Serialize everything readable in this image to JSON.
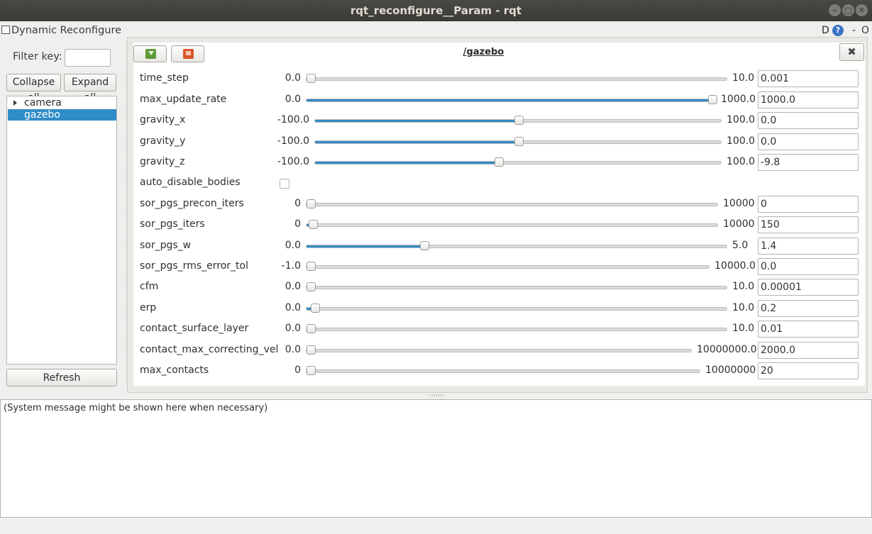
{
  "window": {
    "title": "rqt_reconfigure__Param - rqt",
    "min_glyph": "–",
    "max_glyph": "□",
    "close_glyph": "✕"
  },
  "plugin": {
    "title": "Dynamic Reconfigure",
    "d_label": "D",
    "help_glyph": "?",
    "dash_label": "-",
    "o_label": "O"
  },
  "left_panel": {
    "filter_label": "Filter key:",
    "filter_value": "",
    "collapse_label": "Collapse all",
    "expand_label": "Expand all",
    "refresh_label": "Refresh",
    "tree": [
      {
        "label": "camera",
        "selected": false,
        "expandable": true
      },
      {
        "label": "gazebo",
        "selected": true,
        "expandable": false
      }
    ]
  },
  "group": {
    "title": "/gazebo",
    "close_glyph": "✖",
    "params": [
      {
        "name": "time_step",
        "min": "0.0",
        "max": "10.0",
        "value": "0.001",
        "fraction": 0.0001
      },
      {
        "name": "max_update_rate",
        "min": "0.0",
        "max": "1000.0",
        "value": "1000.0",
        "fraction": 1.0
      },
      {
        "name": "gravity_x",
        "min": "-100.0",
        "max": "100.0",
        "value": "0.0",
        "fraction": 0.5
      },
      {
        "name": "gravity_y",
        "min": "-100.0",
        "max": "100.0",
        "value": "0.0",
        "fraction": 0.5
      },
      {
        "name": "gravity_z",
        "min": "-100.0",
        "max": "100.0",
        "value": "-9.8",
        "fraction": 0.451
      },
      {
        "name": "auto_disable_bodies",
        "type": "bool",
        "checked": false
      },
      {
        "name": "sor_pgs_precon_iters",
        "min": "0",
        "max": "10000",
        "value": "0",
        "fraction": 0.0
      },
      {
        "name": "sor_pgs_iters",
        "min": "0",
        "max": "10000",
        "value": "150",
        "fraction": 0.015
      },
      {
        "name": "sor_pgs_w",
        "min": "0.0",
        "max": "5.0",
        "value": "1.4",
        "fraction": 0.28
      },
      {
        "name": "sor_pgs_rms_error_tol",
        "min": "-1.0",
        "max": "10000.0",
        "value": "0.0",
        "fraction": 0.0001
      },
      {
        "name": "cfm",
        "min": "0.0",
        "max": "10.0",
        "value": "0.00001",
        "fraction": 0.0
      },
      {
        "name": "erp",
        "min": "0.0",
        "max": "10.0",
        "value": "0.2",
        "fraction": 0.02
      },
      {
        "name": "contact_surface_layer",
        "min": "0.0",
        "max": "10.0",
        "value": "0.01",
        "fraction": 0.001
      },
      {
        "name": "contact_max_correcting_vel",
        "min": "0.0",
        "max": "10000000.0",
        "value": "2000.0",
        "fraction": 0.0002
      },
      {
        "name": "max_contacts",
        "min": "0",
        "max": "10000000",
        "value": "20",
        "fraction": 0.0
      }
    ]
  },
  "console": {
    "message": "(System message might be shown here when necessary)"
  }
}
